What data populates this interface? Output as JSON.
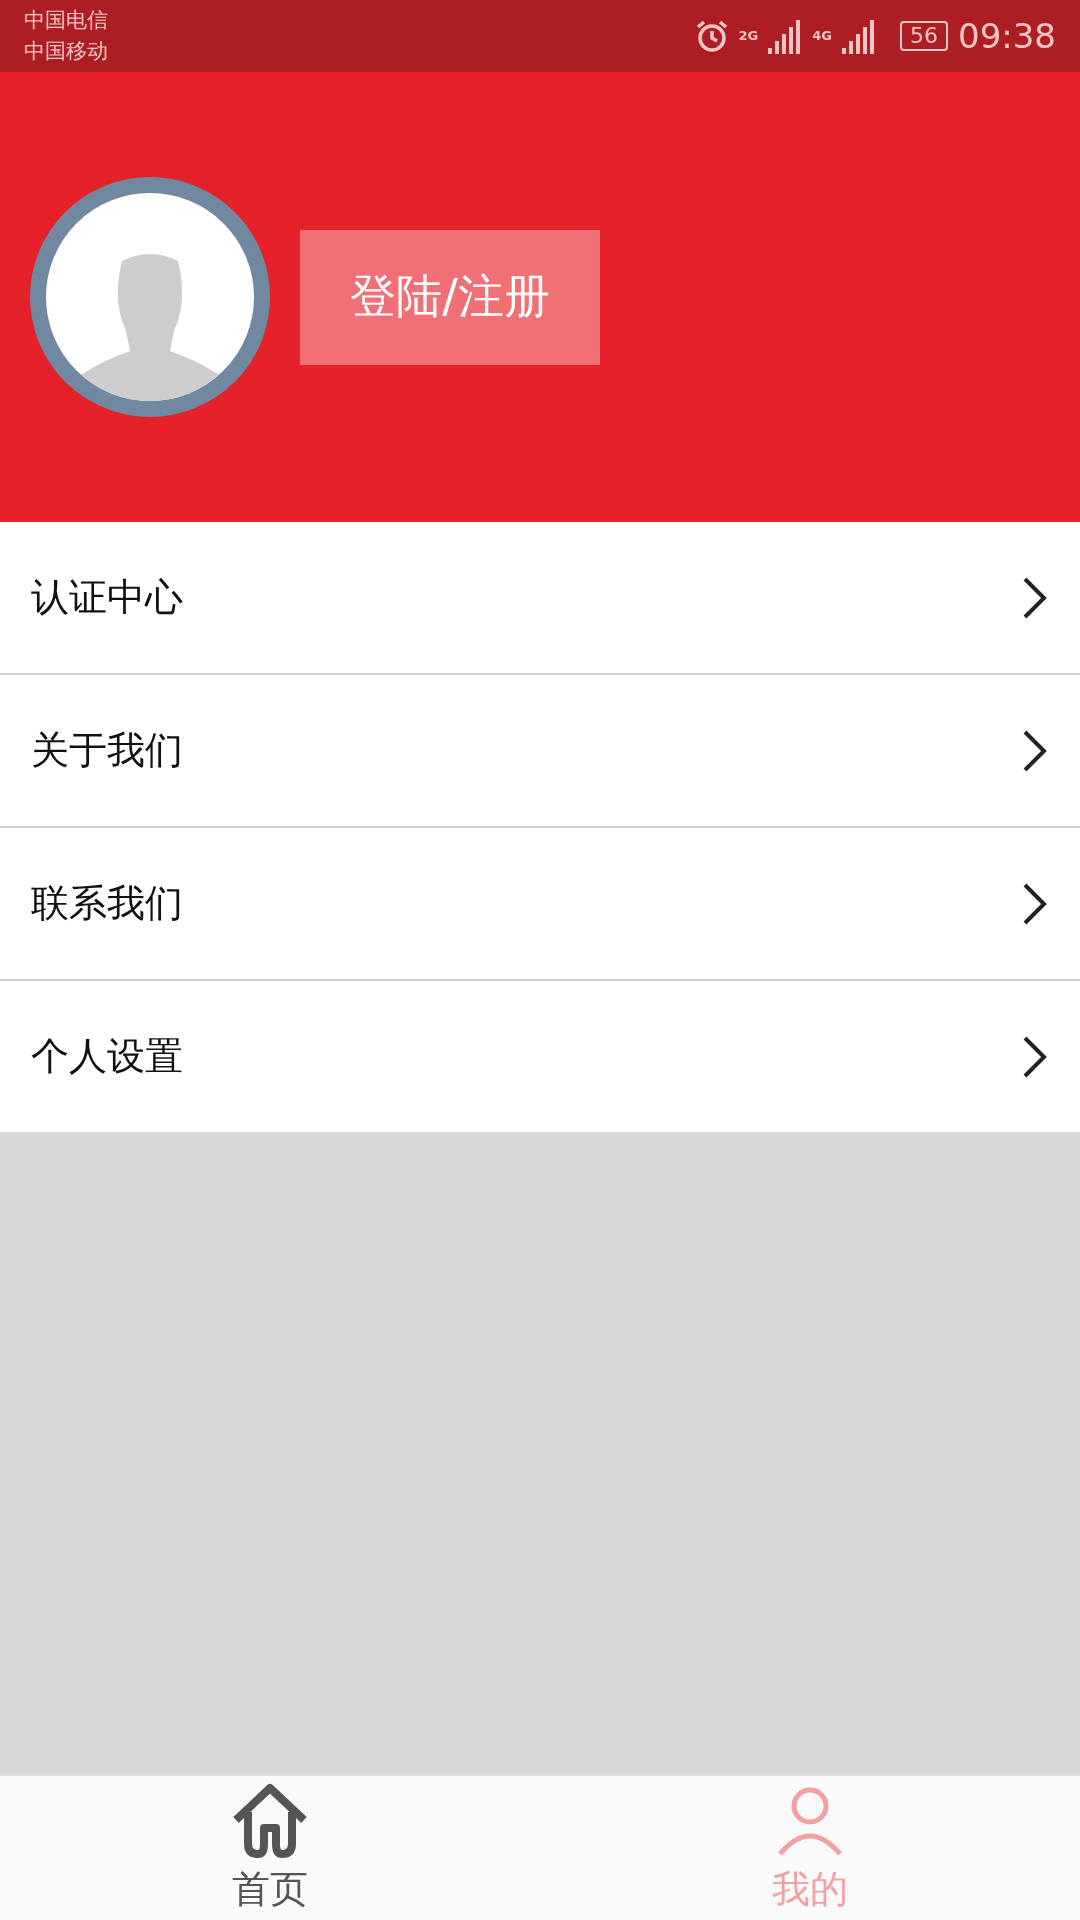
{
  "status_bar": {
    "carriers": [
      "中国电信",
      "中国移动"
    ],
    "network_1": "2G",
    "network_2": "4G",
    "battery": "56",
    "time": "09:38"
  },
  "profile": {
    "login_button": "登陆/注册"
  },
  "menu": [
    {
      "label": "认证中心"
    },
    {
      "label": "关于我们"
    },
    {
      "label": "联系我们"
    },
    {
      "label": "个人设置"
    }
  ],
  "tab_bar": [
    {
      "label": "首页",
      "kind": "home",
      "selected": false
    },
    {
      "label": "我的",
      "kind": "me",
      "selected": true
    }
  ]
}
